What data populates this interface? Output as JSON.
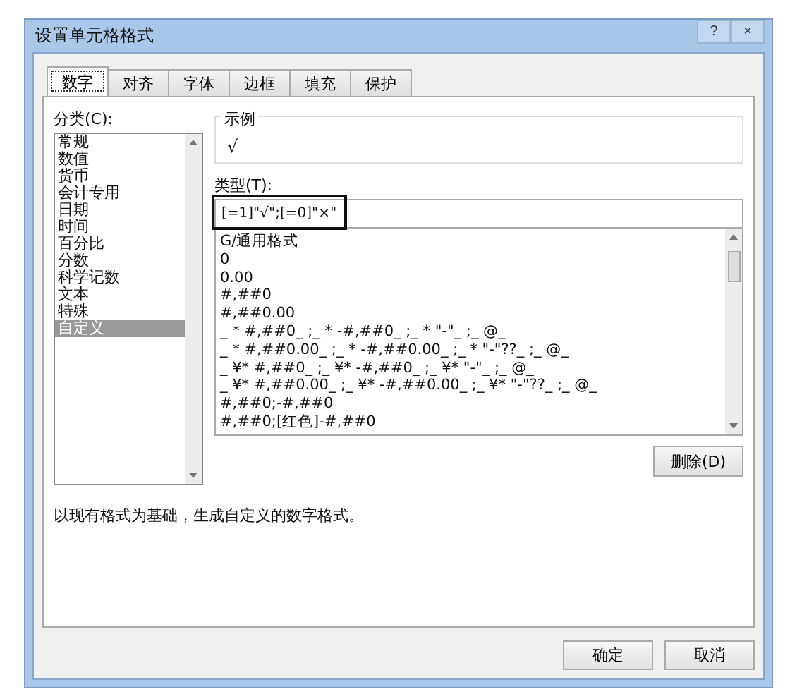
{
  "window": {
    "title": "设置单元格格式",
    "buttons": [
      "?",
      "×"
    ]
  },
  "tabs": [
    {
      "label": "数字",
      "selected": true
    },
    {
      "label": "对齐",
      "selected": false
    },
    {
      "label": "字体",
      "selected": false
    },
    {
      "label": "边框",
      "selected": false
    },
    {
      "label": "填充",
      "selected": false
    },
    {
      "label": "保护",
      "selected": false
    }
  ],
  "category": {
    "label": "分类(C):",
    "items": [
      {
        "label": "常规",
        "selected": false
      },
      {
        "label": "数值",
        "selected": false
      },
      {
        "label": "货币",
        "selected": false
      },
      {
        "label": "会计专用",
        "selected": false
      },
      {
        "label": "日期",
        "selected": false
      },
      {
        "label": "时间",
        "selected": false
      },
      {
        "label": "百分比",
        "selected": false
      },
      {
        "label": "分数",
        "selected": false
      },
      {
        "label": "科学记数",
        "selected": false
      },
      {
        "label": "文本",
        "selected": false
      },
      {
        "label": "特殊",
        "selected": false
      },
      {
        "label": "自定义",
        "selected": true
      }
    ]
  },
  "sample": {
    "label": "示例",
    "value": "√"
  },
  "type": {
    "label": "类型(T):",
    "value": "[=1]\"√\";[=0]\"×\"",
    "highlighted": true,
    "formats": [
      "G/通用格式",
      "0",
      "0.00",
      "#,##0",
      "#,##0.00",
      "_ * #,##0_ ;_ * -#,##0_ ;_ * \"-\"_ ;_ @_",
      "_ * #,##0.00_ ;_ * -#,##0.00_ ;_ * \"-\"??_ ;_ @_",
      "_ ¥* #,##0_ ;_ ¥* -#,##0_ ;_ ¥* \"-\"_ ;_ @_",
      "_ ¥* #,##0.00_ ;_ ¥* -#,##0.00_ ;_ ¥* \"-\"??_ ;_ @_",
      "#,##0;-#,##0",
      "#,##0;[红色]-#,##0"
    ]
  },
  "delete_button": "删除(D)",
  "description": "以现有格式为基础，生成自定义的数字格式。",
  "buttons": [
    "确定",
    "取消"
  ]
}
